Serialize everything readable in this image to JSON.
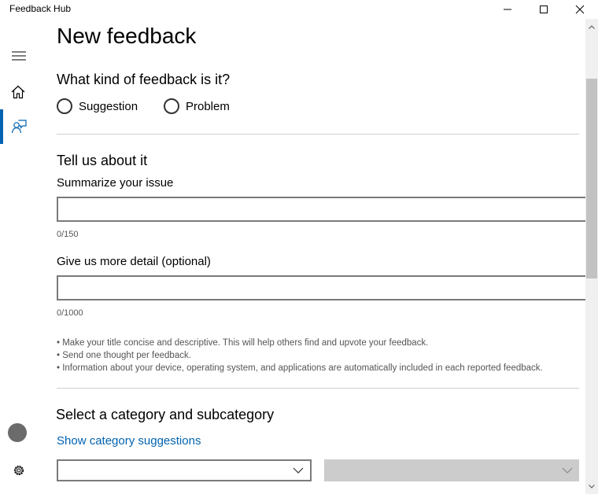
{
  "window": {
    "title": "Feedback Hub"
  },
  "sidebar": {
    "items": [
      {
        "name": "menu-icon"
      },
      {
        "name": "home-icon"
      },
      {
        "name": "feedback-icon",
        "active": true
      },
      {
        "name": "avatar"
      },
      {
        "name": "gear-icon"
      }
    ],
    "accent": "#0063b1"
  },
  "main": {
    "title": "New feedback",
    "kind": {
      "heading": "What kind of feedback is it?",
      "options": [
        "Suggestion",
        "Problem"
      ]
    },
    "about": {
      "heading": "Tell us about it",
      "summary_label": "Summarize your issue",
      "summary_value": "",
      "summary_counter": "0/150",
      "detail_label": "Give us more detail (optional)",
      "detail_value": "",
      "detail_counter": "0/1000",
      "tips": [
        "• Make your title concise and descriptive. This will help others find and upvote your feedback.",
        "• Send one thought per feedback.",
        "• Information about your device, operating system, and applications are automatically included in each reported feedback."
      ]
    },
    "category": {
      "heading": "Select a category and subcategory",
      "link": "Show category suggestions",
      "category_value": "",
      "subcategory_value": ""
    }
  }
}
